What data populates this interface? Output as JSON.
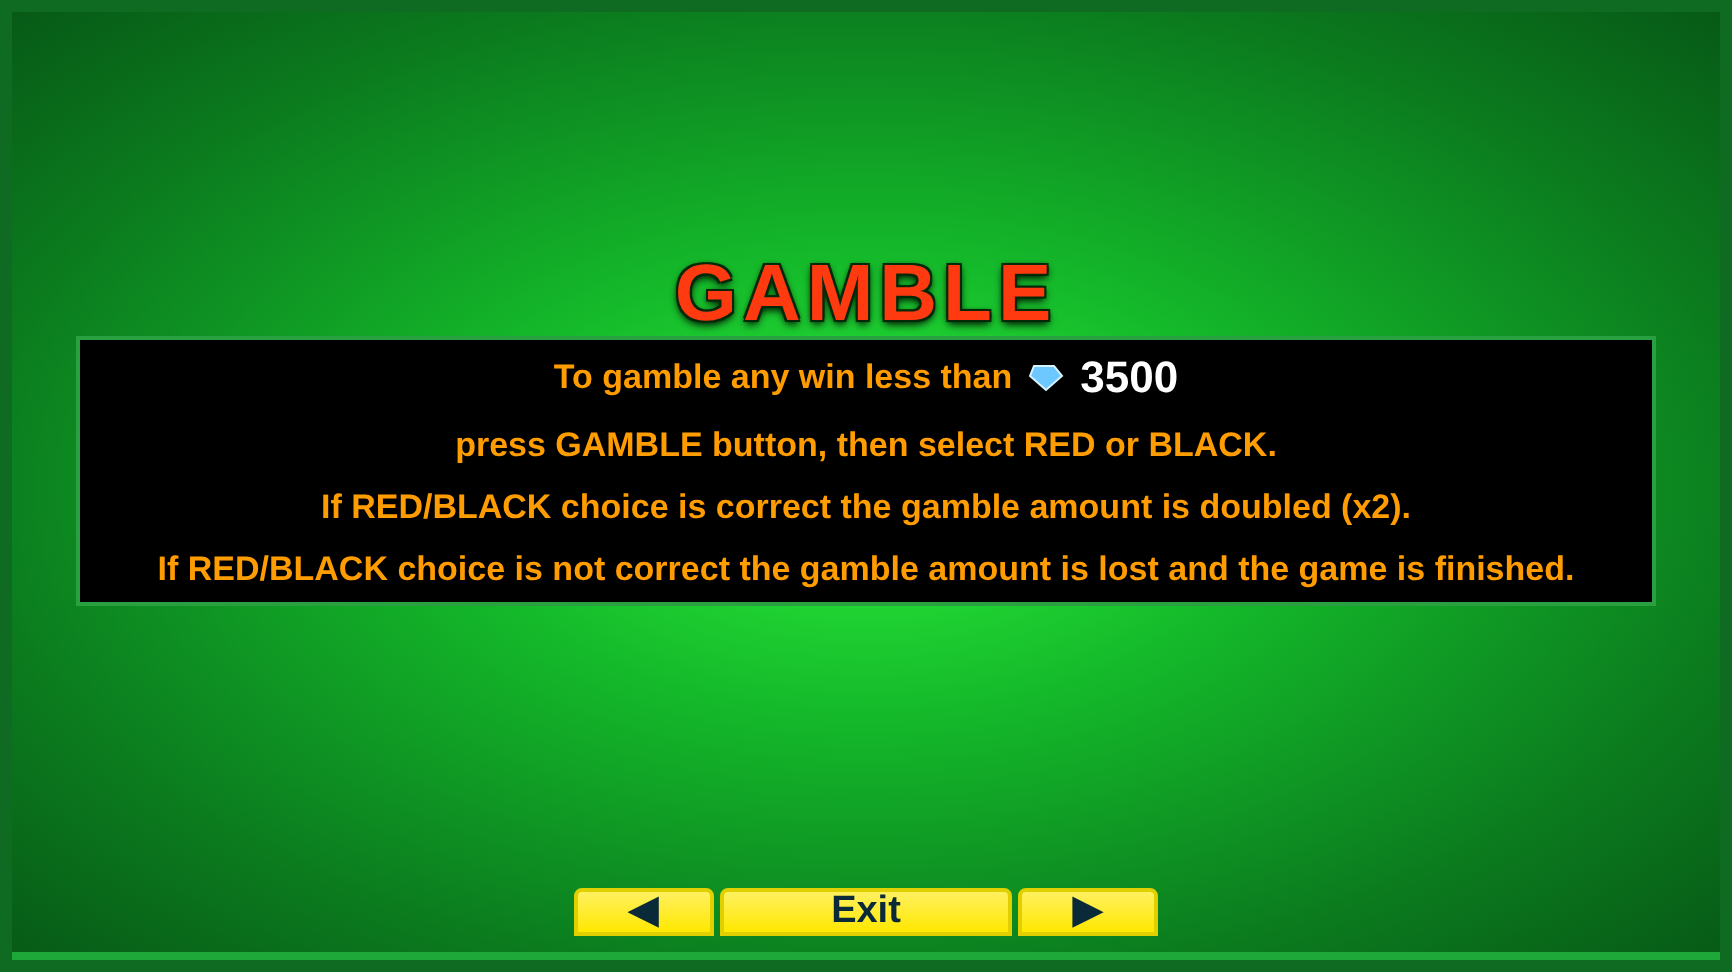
{
  "title": "GAMBLE",
  "info": {
    "intro": "To gamble any win less than",
    "amount": "3500",
    "lines": [
      "press GAMBLE button, then select RED or BLACK.",
      "If RED/BLACK choice is correct the gamble amount is doubled (x2).",
      "If RED/BLACK choice is not correct the gamble amount is lost and the game is finished."
    ]
  },
  "nav": {
    "prev": "◀",
    "exit": "Exit",
    "next": "▶"
  }
}
